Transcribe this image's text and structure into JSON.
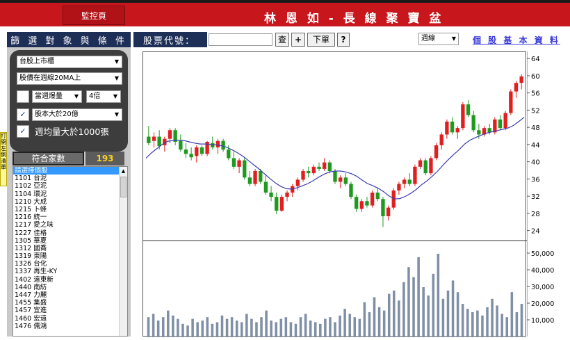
{
  "header": {
    "monitor_button": "監控頁",
    "app_title": "林 恩 如 - 長 線 聚 寶 盆"
  },
  "filter_panel": {
    "title": "篩 選 對 象 與 條 件",
    "market_select": "台股上市櫃",
    "ma_select": "股價在週線20MA上",
    "volume_check": false,
    "volume_select": "當週爆量",
    "multiple_select": "4倍",
    "capital_check": true,
    "capital_select": "股本大於20億",
    "avg_volume_check": true,
    "avg_volume_label": "週均量大於1000張",
    "match_label": "符合家數",
    "match_count": "193"
  },
  "side_tab": "打開左側清單",
  "stock_list": {
    "items": [
      "請選擇個股",
      "1101 台泥",
      "1102 亞泥",
      "1104 環泥",
      "1210 大成",
      "1215 卜蜂",
      "1216 統一",
      "1217 愛之味",
      "1227 佳格",
      "1305 華夏",
      "1312 國喬",
      "1319 東陽",
      "1326 台化",
      "1337 再生-KY",
      "1402 遠東新",
      "1440 南紡",
      "1447 力麗",
      "1455 集盛",
      "1457 宜進",
      "1460 宏遠",
      "1476 儒鴻"
    ]
  },
  "toolbar": {
    "stock_code_label": "股票代號：",
    "stock_code_value": "",
    "search_button": "查",
    "add_button": "+",
    "order_button": "下單",
    "help_button": "?",
    "period_select": "週線",
    "info_link": "個 股 基 本 資 料"
  },
  "colors": {
    "header_red": "#c8161d",
    "navy": "#1e2f57",
    "up_candle": "#e02020",
    "down_candle": "#1f9a1f",
    "ma_line": "#3b3bb0",
    "volume_bar": "#7f8fa6"
  },
  "chart_data": [
    {
      "type": "candlestick",
      "ylim": [
        22,
        65
      ],
      "yticks": [
        24,
        28,
        32,
        36,
        40,
        44,
        48,
        52,
        56,
        60,
        64
      ],
      "series": [
        {
          "values": [
            {
              "o": 46,
              "h": 48.5,
              "l": 44,
              "c": 44.5
            },
            {
              "o": 45,
              "h": 47,
              "l": 43.5,
              "c": 46
            },
            {
              "o": 46,
              "h": 47.5,
              "l": 43,
              "c": 43.8
            },
            {
              "o": 44,
              "h": 46,
              "l": 42.5,
              "c": 45.5
            },
            {
              "o": 45.5,
              "h": 48,
              "l": 44.5,
              "c": 47.5
            },
            {
              "o": 47.5,
              "h": 48,
              "l": 44,
              "c": 44.8
            },
            {
              "o": 45,
              "h": 46.5,
              "l": 42.5,
              "c": 43
            },
            {
              "o": 43,
              "h": 44.5,
              "l": 41,
              "c": 42
            },
            {
              "o": 42,
              "h": 43.5,
              "l": 40.5,
              "c": 41.2
            },
            {
              "o": 41.5,
              "h": 44,
              "l": 40,
              "c": 43.5
            },
            {
              "o": 43.5,
              "h": 44,
              "l": 41.5,
              "c": 42
            },
            {
              "o": 42,
              "h": 45,
              "l": 41.5,
              "c": 44.8
            },
            {
              "o": 44.5,
              "h": 46,
              "l": 43,
              "c": 43.5
            },
            {
              "o": 43.5,
              "h": 45.5,
              "l": 42,
              "c": 45
            },
            {
              "o": 45,
              "h": 45.5,
              "l": 42.5,
              "c": 43
            },
            {
              "o": 43,
              "h": 44,
              "l": 40.5,
              "c": 41
            },
            {
              "o": 41,
              "h": 42.5,
              "l": 38.5,
              "c": 39
            },
            {
              "o": 39,
              "h": 41,
              "l": 37.5,
              "c": 40.5
            },
            {
              "o": 40.5,
              "h": 41,
              "l": 36,
              "c": 36.5
            },
            {
              "o": 36.5,
              "h": 38,
              "l": 34.5,
              "c": 35
            },
            {
              "o": 35,
              "h": 38.5,
              "l": 34.5,
              "c": 38
            },
            {
              "o": 38,
              "h": 38.5,
              "l": 35,
              "c": 35.5
            },
            {
              "o": 35.5,
              "h": 37,
              "l": 32.5,
              "c": 33
            },
            {
              "o": 33,
              "h": 34.5,
              "l": 31,
              "c": 32
            },
            {
              "o": 32,
              "h": 33,
              "l": 28,
              "c": 28.8
            },
            {
              "o": 28.8,
              "h": 32.5,
              "l": 28.5,
              "c": 32
            },
            {
              "o": 32,
              "h": 33.5,
              "l": 31,
              "c": 33
            },
            {
              "o": 33,
              "h": 35,
              "l": 32,
              "c": 34.5
            },
            {
              "o": 34.5,
              "h": 36.5,
              "l": 33.5,
              "c": 36
            },
            {
              "o": 36,
              "h": 38.5,
              "l": 35.5,
              "c": 38
            },
            {
              "o": 38,
              "h": 39,
              "l": 36.5,
              "c": 37.5
            },
            {
              "o": 37.5,
              "h": 39.5,
              "l": 37,
              "c": 39
            },
            {
              "o": 39,
              "h": 40,
              "l": 38,
              "c": 38.5
            },
            {
              "o": 38.5,
              "h": 41,
              "l": 38,
              "c": 40
            },
            {
              "o": 40,
              "h": 40.5,
              "l": 37.5,
              "c": 38
            },
            {
              "o": 38,
              "h": 38.5,
              "l": 35,
              "c": 35.5
            },
            {
              "o": 35.5,
              "h": 37,
              "l": 34,
              "c": 36.5
            },
            {
              "o": 36.5,
              "h": 37.5,
              "l": 34.5,
              "c": 35
            },
            {
              "o": 35,
              "h": 35.5,
              "l": 31.5,
              "c": 32
            },
            {
              "o": 32,
              "h": 32.5,
              "l": 28.5,
              "c": 29.2
            },
            {
              "o": 29.2,
              "h": 31.5,
              "l": 28.5,
              "c": 31
            },
            {
              "o": 31,
              "h": 32,
              "l": 29.5,
              "c": 30
            },
            {
              "o": 30,
              "h": 33.5,
              "l": 29.5,
              "c": 33
            },
            {
              "o": 33,
              "h": 34,
              "l": 31,
              "c": 31.5
            },
            {
              "o": 31.5,
              "h": 32,
              "l": 25,
              "c": 27.5
            },
            {
              "o": 27.5,
              "h": 30,
              "l": 26.5,
              "c": 29.5
            },
            {
              "o": 29.5,
              "h": 34,
              "l": 29,
              "c": 33.5
            },
            {
              "o": 33.5,
              "h": 35.5,
              "l": 32.5,
              "c": 35
            },
            {
              "o": 35,
              "h": 36.5,
              "l": 34,
              "c": 36
            },
            {
              "o": 36,
              "h": 37.5,
              "l": 34.5,
              "c": 35
            },
            {
              "o": 35,
              "h": 39.5,
              "l": 34.5,
              "c": 39
            },
            {
              "o": 39,
              "h": 41,
              "l": 38.5,
              "c": 40.5
            },
            {
              "o": 40.5,
              "h": 41,
              "l": 37,
              "c": 37.5
            },
            {
              "o": 37.5,
              "h": 41.5,
              "l": 37,
              "c": 41
            },
            {
              "o": 41,
              "h": 44.5,
              "l": 40.5,
              "c": 44
            },
            {
              "o": 44,
              "h": 47,
              "l": 43,
              "c": 46.5
            },
            {
              "o": 46.5,
              "h": 50,
              "l": 45.5,
              "c": 49.5
            },
            {
              "o": 49.5,
              "h": 50.5,
              "l": 46.5,
              "c": 47
            },
            {
              "o": 47,
              "h": 48.5,
              "l": 45.5,
              "c": 48
            },
            {
              "o": 48,
              "h": 54,
              "l": 47.5,
              "c": 53.5
            },
            {
              "o": 53.5,
              "h": 54.5,
              "l": 50.5,
              "c": 51
            },
            {
              "o": 51,
              "h": 52,
              "l": 47,
              "c": 47.5
            },
            {
              "o": 47.5,
              "h": 49,
              "l": 45.5,
              "c": 46.5
            },
            {
              "o": 46.5,
              "h": 48.5,
              "l": 46,
              "c": 48
            },
            {
              "o": 48,
              "h": 49,
              "l": 46.5,
              "c": 47
            },
            {
              "o": 47,
              "h": 50.5,
              "l": 46.5,
              "c": 50
            },
            {
              "o": 50,
              "h": 51,
              "l": 47.5,
              "c": 48
            },
            {
              "o": 48,
              "h": 52,
              "l": 47.5,
              "c": 51.5
            },
            {
              "o": 51.5,
              "h": 57,
              "l": 51,
              "c": 56.5
            },
            {
              "o": 56.5,
              "h": 59,
              "l": 55,
              "c": 58.5
            },
            {
              "o": 58.5,
              "h": 60.5,
              "l": 57,
              "c": 60
            }
          ]
        },
        {
          "name": "",
          "values": [
            41,
            42.2,
            43.2,
            44.2,
            44.9,
            45.1,
            45.2,
            45.1,
            44.8,
            44.5,
            44.3,
            44.3,
            44.2,
            44.1,
            43.9,
            43.5,
            42.9,
            42.2,
            41.4,
            40.4,
            39.4,
            38.4,
            37.3,
            36.2,
            35.2,
            34.4,
            33.9,
            33.8,
            34.1,
            34.6,
            35.1,
            35.8,
            36.6,
            37.3,
            37.8,
            38,
            38,
            37.8,
            37.4,
            36.8,
            35.9,
            35.1,
            34.6,
            34,
            33.2,
            32.2,
            31.5,
            31.6,
            32.1,
            32.8,
            33.7,
            34.8,
            35.7,
            36.8,
            38,
            39.4,
            40.7,
            41.9,
            43,
            44.3,
            45.2,
            45.8,
            46.3,
            46.8,
            47.1,
            47.4,
            47.7,
            48,
            48.6,
            49.5,
            50.5
          ]
        }
      ]
    },
    {
      "type": "bar",
      "ylim": [
        0,
        55000
      ],
      "yticks": [
        "10,000",
        "20,000",
        "30,000",
        "40,000",
        "50,000"
      ],
      "values": [
        12000,
        14000,
        10000,
        12000,
        16000,
        13000,
        11000,
        8000,
        7000,
        11000,
        9000,
        10000,
        12000,
        8000,
        9000,
        13000,
        11000,
        12000,
        10000,
        9000,
        14000,
        11000,
        9000,
        12000,
        16000,
        10000,
        9000,
        11000,
        12000,
        9000,
        8000,
        12000,
        14000,
        10000,
        9000,
        8000,
        11000,
        12000,
        9000,
        13000,
        17000,
        14000,
        12000,
        11000,
        21000,
        15000,
        24000,
        18000,
        16000,
        26000,
        28000,
        22000,
        33000,
        42000,
        36000,
        48000,
        30000,
        25000,
        38000,
        50000,
        23000,
        28000,
        34000,
        27000,
        20000,
        17000,
        15000,
        16000,
        13000,
        18000,
        23000,
        19000,
        14000,
        12000,
        27000,
        15000,
        20000
      ]
    }
  ]
}
